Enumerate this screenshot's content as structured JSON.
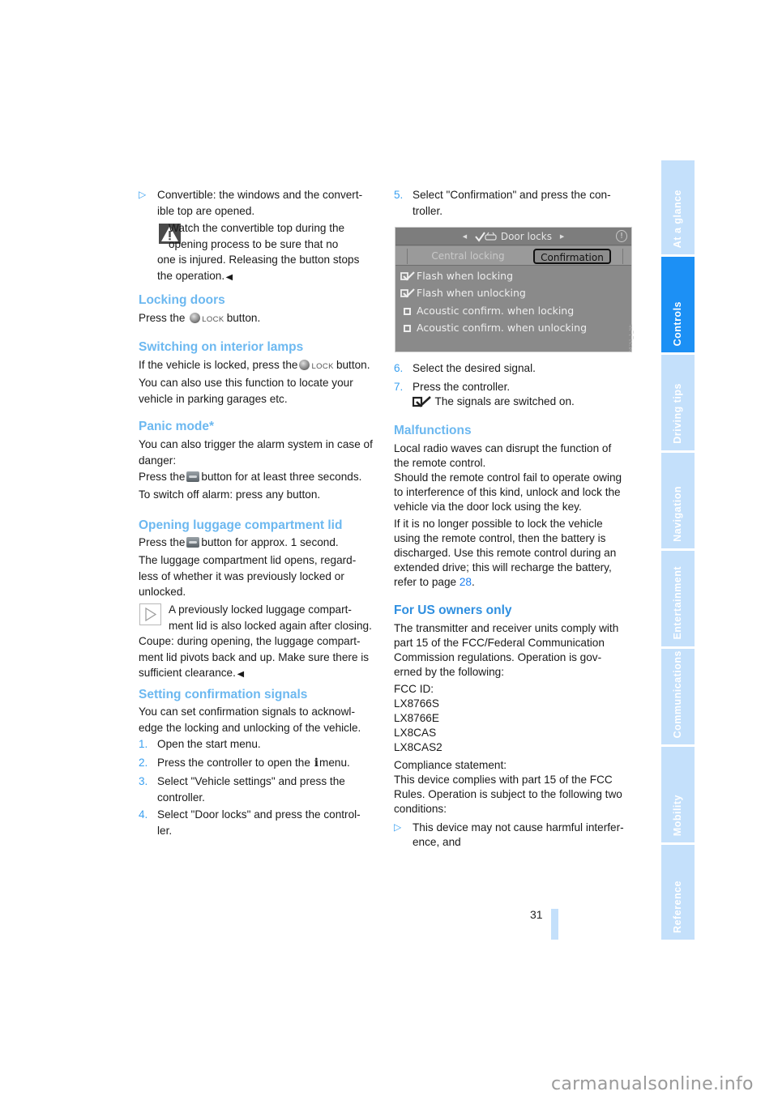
{
  "left_column": {
    "bullet_convertible": "Convertible: the windows and the convertible top are opened.",
    "bullet_convertible_l1": "Convertible: the windows and the convert-",
    "bullet_convertible_l2": "ible top are opened.",
    "warning": {
      "l1": "Watch the convertible top during the",
      "l2": "opening process to be sure that no",
      "l3": "one is injured. Releasing the button stops",
      "l4": "the operation."
    },
    "locking_doors": {
      "heading": "Locking doors",
      "text_before": "Press the",
      "lock_label": "LOCK",
      "text_after": "button."
    },
    "interior_lamps": {
      "heading": "Switching on interior lamps",
      "p1_before": "If the vehicle is locked, press the",
      "lock_label": "LOCK",
      "p1_after": "button.",
      "p2_l1": "You can also use this function to locate your",
      "p2_l2": "vehicle in parking garages etc."
    },
    "panic_mode": {
      "heading": "Panic mode*",
      "p1_l1": "You can also trigger the alarm system in case of",
      "p1_l2": "danger:",
      "p2_before": "Press the",
      "p2_after": "button for at least three seconds.",
      "p3": "To switch off alarm: press any button."
    },
    "luggage": {
      "heading": "Opening luggage compartment lid",
      "p1_before": "Press the",
      "p1_after": "button for approx. 1 second.",
      "p2_l1": "The luggage compartment lid opens, regard-",
      "p2_l2": "less of whether it was previously locked or",
      "p2_l3": "unlocked.",
      "note_l1": "A previously locked luggage compart-",
      "note_l2": "ment lid is also locked again after closing.",
      "note_l3": "Coupe: during opening, the luggage compart-",
      "note_l4": "ment lid pivots back and up. Make sure there is",
      "note_l5": "sufficient clearance."
    },
    "confirmation": {
      "heading": "Setting confirmation signals",
      "p1_l1": "You can set confirmation signals to acknowl-",
      "p1_l2": "edge the locking and unlocking of the vehicle.",
      "steps": [
        {
          "num": "1.",
          "l1": "Open the start menu.",
          "l2": ""
        },
        {
          "num": "2.",
          "l1_before": "Press the controller to open the",
          "icon": "i",
          "l1_after": "menu."
        },
        {
          "num": "3.",
          "l1": "Select \"Vehicle settings\" and press the",
          "l2": "controller."
        },
        {
          "num": "4.",
          "l1": "Select \"Door locks\" and press the control-",
          "l2": "ler."
        }
      ]
    }
  },
  "right_column": {
    "step5": {
      "num": "5.",
      "l1": "Select \"Confirmation\" and press the con-",
      "l2": "troller."
    },
    "screen": {
      "title": "Door locks",
      "tabs": [
        "Central locking",
        "Confirmation"
      ],
      "active_tab": "Confirmation",
      "options": [
        {
          "label": "Flash when locking",
          "checked": true
        },
        {
          "label": "Flash when unlocking",
          "checked": true
        },
        {
          "label": "Acoustic confirm. when locking",
          "checked": false
        },
        {
          "label": "Acoustic confirm. when unlocking",
          "checked": false
        }
      ],
      "image_code": "VCS1_1_SE"
    },
    "step6": {
      "num": "6.",
      "l1": "Select the desired signal."
    },
    "step7": {
      "num": "7.",
      "l1": "Press the controller.",
      "l2": "The signals are switched on."
    },
    "malfunctions": {
      "heading": "Malfunctions",
      "p1_l1": "Local radio waves can disrupt the function of",
      "p1_l2": "the remote control.",
      "p1_l3": "Should the remote control fail to operate owing",
      "p1_l4": "to interference of this kind, unlock and lock the",
      "p1_l5": "vehicle via the door lock using the key.",
      "p2_l1": "If it is no longer possible to lock the vehicle",
      "p2_l2": "using the remote control, then the battery is",
      "p2_l3": "discharged. Use this remote control during an",
      "p2_l4": "extended drive; this will recharge the battery,",
      "p2_l5_before": "refer to page",
      "p2_l5_link": "28",
      "p2_l5_after": "."
    },
    "us_owners": {
      "heading": "For US owners only",
      "p1_l1": "The transmitter and receiver units comply with",
      "p1_l2": "part 15 of the FCC/Federal Communication",
      "p1_l3": "Commission regulations. Operation is gov-",
      "p1_l4": "erned by the following:",
      "fcc_label": "FCC ID:",
      "fcc_ids": [
        "LX8766S",
        "LX8766E",
        "LX8CAS",
        "LX8CAS2"
      ],
      "compliance_l1": "Compliance statement:",
      "compliance_l2": "This device complies with part 15 of the FCC",
      "compliance_l3": "Rules. Operation is subject to the following two",
      "compliance_l4": "conditions:",
      "bullet_l1": "This device may not cause harmful interfer-",
      "bullet_l2": "ence, and"
    }
  },
  "sidebar": {
    "tabs": [
      "At a glance",
      "Controls",
      "Driving tips",
      "Navigation",
      "Entertainment",
      "Communications",
      "Mobility",
      "Reference"
    ],
    "active": "Controls"
  },
  "footer": {
    "page_number": "31",
    "watermark": "carmanualsonline.info"
  },
  "colors": {
    "heading": "#6cb8f0",
    "heading_dark": "#2f8fe0",
    "accent": "#3aa0f0",
    "sidebar_active": "#1c90f5",
    "sidebar_inactive": "#c4e0fb"
  }
}
